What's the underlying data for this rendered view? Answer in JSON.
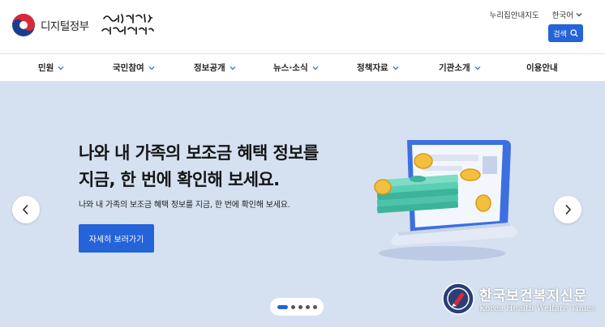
{
  "header": {
    "logo_text": "디지털정부",
    "slogan": "다시 대한민국! 새로운 국민의 나라",
    "util_links": [
      "누리집안내지도",
      "한국어"
    ],
    "search_label": "검색"
  },
  "nav": {
    "items": [
      {
        "label": "민원"
      },
      {
        "label": "국민참여"
      },
      {
        "label": "정보공개"
      },
      {
        "label": "뉴스·소식"
      },
      {
        "label": "정책자료"
      },
      {
        "label": "기관소개"
      },
      {
        "label": "이용안내"
      }
    ]
  },
  "hero": {
    "title_line1": "나와 내 가족의 보조금 혜택 정보를",
    "title_line2": "지금, 한 번에 확인해 보세요.",
    "subtitle": "나와 내 가족의 보조금 혜택 정보를 지금, 한 번에 확인해 보세요.",
    "cta_label": "자세히 보러가기",
    "background_color": "#d5e1f1",
    "accent_color": "#2563d9"
  },
  "pager": {
    "total": 5,
    "active": 1
  },
  "watermark": {
    "korean": "한국보건복지신문",
    "english": "Korea Health Welfare Times"
  }
}
